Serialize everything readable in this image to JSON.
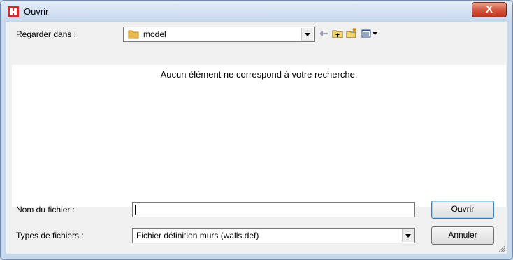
{
  "window": {
    "title": "Ouvrir",
    "close_label": "X"
  },
  "look_in": {
    "label": "Regarder dans :",
    "value": "model"
  },
  "toolbar": {
    "icons": [
      "back-arrow-icon",
      "up-folder-icon",
      "new-folder-icon",
      "view-menu-icon"
    ]
  },
  "filelist": {
    "empty_message": "Aucun élément ne correspond à votre recherche."
  },
  "filename": {
    "label": "Nom du fichier :",
    "value": ""
  },
  "filetype": {
    "label": "Types de fichiers :",
    "value": "Fichier définition murs (walls.def)"
  },
  "buttons": {
    "open": "Ouvrir",
    "cancel": "Annuler"
  },
  "colors": {
    "title_bg": "#c8d8ec",
    "close_button": "#c2341b",
    "dialog_bg": "#f0f0f0"
  }
}
